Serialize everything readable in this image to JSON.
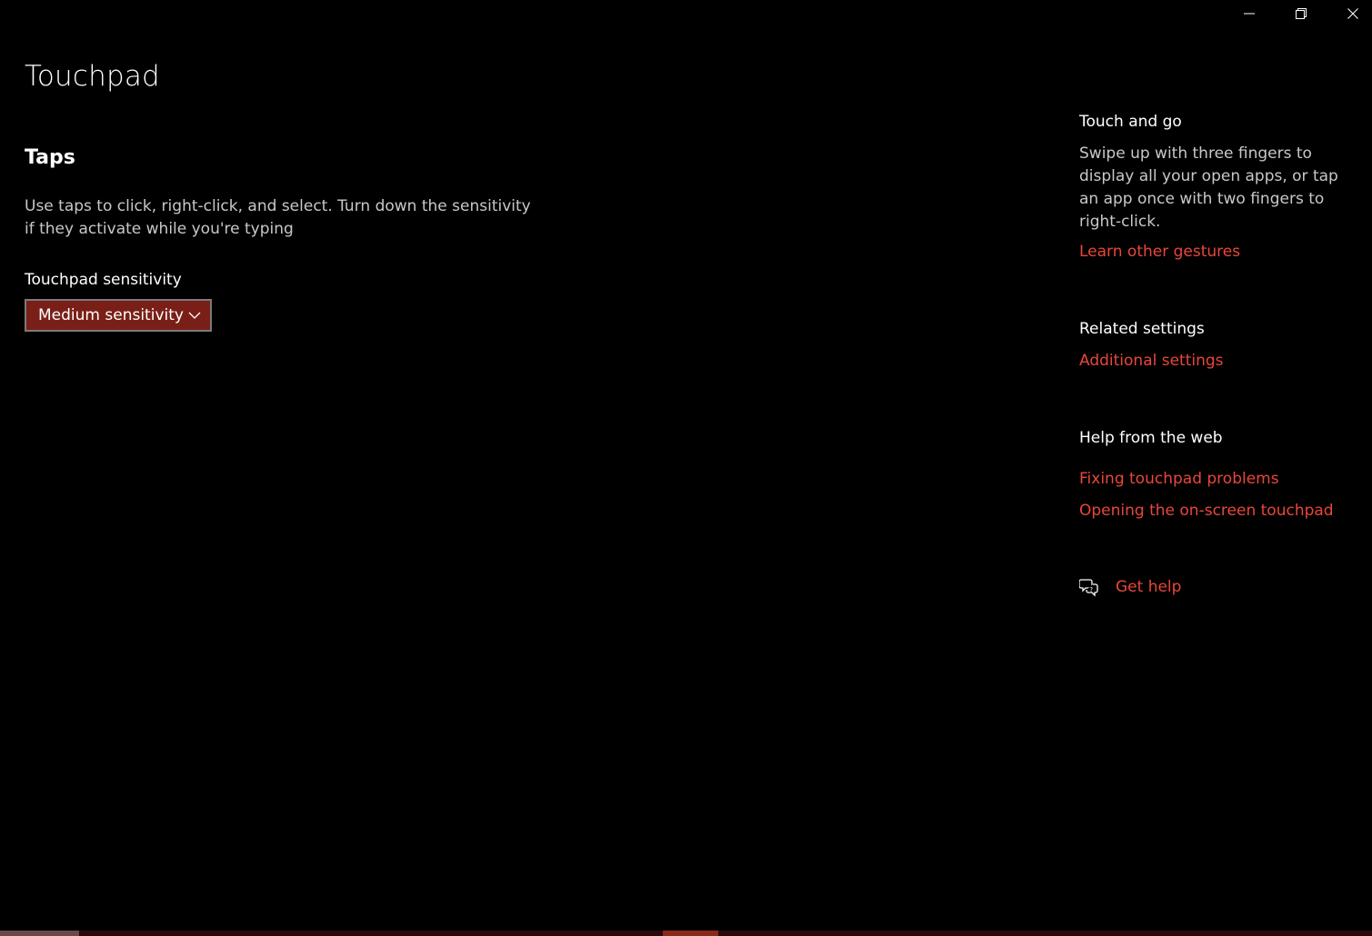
{
  "window": {
    "controls": {
      "minimize_icon": "minimize-icon",
      "restore_icon": "restore-icon",
      "close_icon": "close-icon"
    }
  },
  "main": {
    "title": "Touchpad",
    "section": {
      "title": "Taps",
      "description": "Use taps to click, right-click, and select. Turn down the sensitivity if they activate while you're typing",
      "sensitivity_label": "Touchpad sensitivity",
      "sensitivity_value": "Medium sensitivity"
    }
  },
  "side": {
    "touch_and_go": {
      "heading": "Touch and go",
      "text": "Swipe up with three fingers to display all your open apps, or tap an app once with two fingers to right-click.",
      "link": "Learn other gestures"
    },
    "related": {
      "heading": "Related settings",
      "link": "Additional settings"
    },
    "web_help": {
      "heading": "Help from the web",
      "links": [
        "Fixing touchpad problems",
        "Opening the on-screen touchpad"
      ]
    },
    "get_help": {
      "label": "Get help",
      "icon": "chat-help-icon"
    }
  },
  "colors": {
    "background": "#000000",
    "accent_link": "#e8473a",
    "select_fill": "#7a1f17",
    "select_border": "#7a7a7a",
    "secondary_text": "#c8c8c8"
  }
}
